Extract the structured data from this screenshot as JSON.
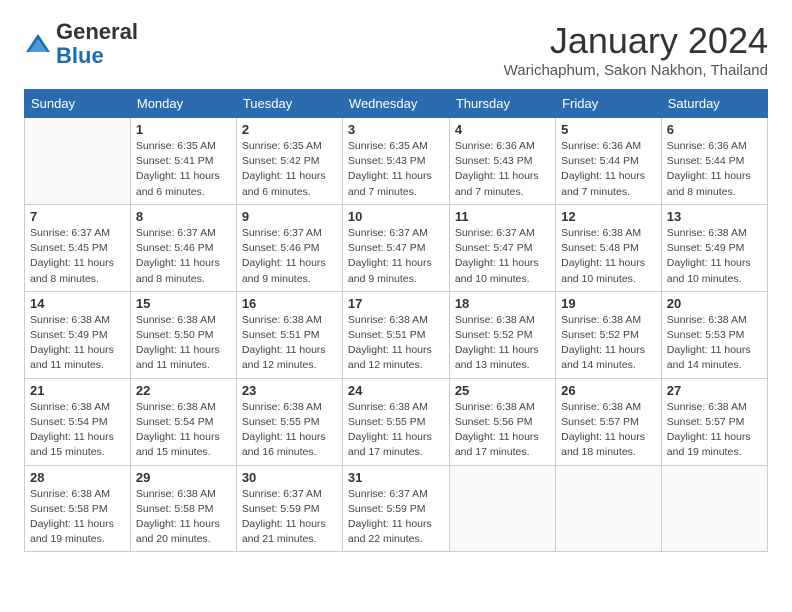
{
  "logo": {
    "general": "General",
    "blue": "Blue"
  },
  "header": {
    "month": "January 2024",
    "location": "Warichaphum, Sakon Nakhon, Thailand"
  },
  "weekdays": [
    "Sunday",
    "Monday",
    "Tuesday",
    "Wednesday",
    "Thursday",
    "Friday",
    "Saturday"
  ],
  "weeks": [
    [
      {
        "day": "",
        "info": ""
      },
      {
        "day": "1",
        "info": "Sunrise: 6:35 AM\nSunset: 5:41 PM\nDaylight: 11 hours and 6 minutes."
      },
      {
        "day": "2",
        "info": "Sunrise: 6:35 AM\nSunset: 5:42 PM\nDaylight: 11 hours and 6 minutes."
      },
      {
        "day": "3",
        "info": "Sunrise: 6:35 AM\nSunset: 5:43 PM\nDaylight: 11 hours and 7 minutes."
      },
      {
        "day": "4",
        "info": "Sunrise: 6:36 AM\nSunset: 5:43 PM\nDaylight: 11 hours and 7 minutes."
      },
      {
        "day": "5",
        "info": "Sunrise: 6:36 AM\nSunset: 5:44 PM\nDaylight: 11 hours and 7 minutes."
      },
      {
        "day": "6",
        "info": "Sunrise: 6:36 AM\nSunset: 5:44 PM\nDaylight: 11 hours and 8 minutes."
      }
    ],
    [
      {
        "day": "7",
        "info": "Sunrise: 6:37 AM\nSunset: 5:45 PM\nDaylight: 11 hours and 8 minutes."
      },
      {
        "day": "8",
        "info": "Sunrise: 6:37 AM\nSunset: 5:46 PM\nDaylight: 11 hours and 8 minutes."
      },
      {
        "day": "9",
        "info": "Sunrise: 6:37 AM\nSunset: 5:46 PM\nDaylight: 11 hours and 9 minutes."
      },
      {
        "day": "10",
        "info": "Sunrise: 6:37 AM\nSunset: 5:47 PM\nDaylight: 11 hours and 9 minutes."
      },
      {
        "day": "11",
        "info": "Sunrise: 6:37 AM\nSunset: 5:47 PM\nDaylight: 11 hours and 10 minutes."
      },
      {
        "day": "12",
        "info": "Sunrise: 6:38 AM\nSunset: 5:48 PM\nDaylight: 11 hours and 10 minutes."
      },
      {
        "day": "13",
        "info": "Sunrise: 6:38 AM\nSunset: 5:49 PM\nDaylight: 11 hours and 10 minutes."
      }
    ],
    [
      {
        "day": "14",
        "info": "Sunrise: 6:38 AM\nSunset: 5:49 PM\nDaylight: 11 hours and 11 minutes."
      },
      {
        "day": "15",
        "info": "Sunrise: 6:38 AM\nSunset: 5:50 PM\nDaylight: 11 hours and 11 minutes."
      },
      {
        "day": "16",
        "info": "Sunrise: 6:38 AM\nSunset: 5:51 PM\nDaylight: 11 hours and 12 minutes."
      },
      {
        "day": "17",
        "info": "Sunrise: 6:38 AM\nSunset: 5:51 PM\nDaylight: 11 hours and 12 minutes."
      },
      {
        "day": "18",
        "info": "Sunrise: 6:38 AM\nSunset: 5:52 PM\nDaylight: 11 hours and 13 minutes."
      },
      {
        "day": "19",
        "info": "Sunrise: 6:38 AM\nSunset: 5:52 PM\nDaylight: 11 hours and 14 minutes."
      },
      {
        "day": "20",
        "info": "Sunrise: 6:38 AM\nSunset: 5:53 PM\nDaylight: 11 hours and 14 minutes."
      }
    ],
    [
      {
        "day": "21",
        "info": "Sunrise: 6:38 AM\nSunset: 5:54 PM\nDaylight: 11 hours and 15 minutes."
      },
      {
        "day": "22",
        "info": "Sunrise: 6:38 AM\nSunset: 5:54 PM\nDaylight: 11 hours and 15 minutes."
      },
      {
        "day": "23",
        "info": "Sunrise: 6:38 AM\nSunset: 5:55 PM\nDaylight: 11 hours and 16 minutes."
      },
      {
        "day": "24",
        "info": "Sunrise: 6:38 AM\nSunset: 5:55 PM\nDaylight: 11 hours and 17 minutes."
      },
      {
        "day": "25",
        "info": "Sunrise: 6:38 AM\nSunset: 5:56 PM\nDaylight: 11 hours and 17 minutes."
      },
      {
        "day": "26",
        "info": "Sunrise: 6:38 AM\nSunset: 5:57 PM\nDaylight: 11 hours and 18 minutes."
      },
      {
        "day": "27",
        "info": "Sunrise: 6:38 AM\nSunset: 5:57 PM\nDaylight: 11 hours and 19 minutes."
      }
    ],
    [
      {
        "day": "28",
        "info": "Sunrise: 6:38 AM\nSunset: 5:58 PM\nDaylight: 11 hours and 19 minutes."
      },
      {
        "day": "29",
        "info": "Sunrise: 6:38 AM\nSunset: 5:58 PM\nDaylight: 11 hours and 20 minutes."
      },
      {
        "day": "30",
        "info": "Sunrise: 6:37 AM\nSunset: 5:59 PM\nDaylight: 11 hours and 21 minutes."
      },
      {
        "day": "31",
        "info": "Sunrise: 6:37 AM\nSunset: 5:59 PM\nDaylight: 11 hours and 22 minutes."
      },
      {
        "day": "",
        "info": ""
      },
      {
        "day": "",
        "info": ""
      },
      {
        "day": "",
        "info": ""
      }
    ]
  ]
}
